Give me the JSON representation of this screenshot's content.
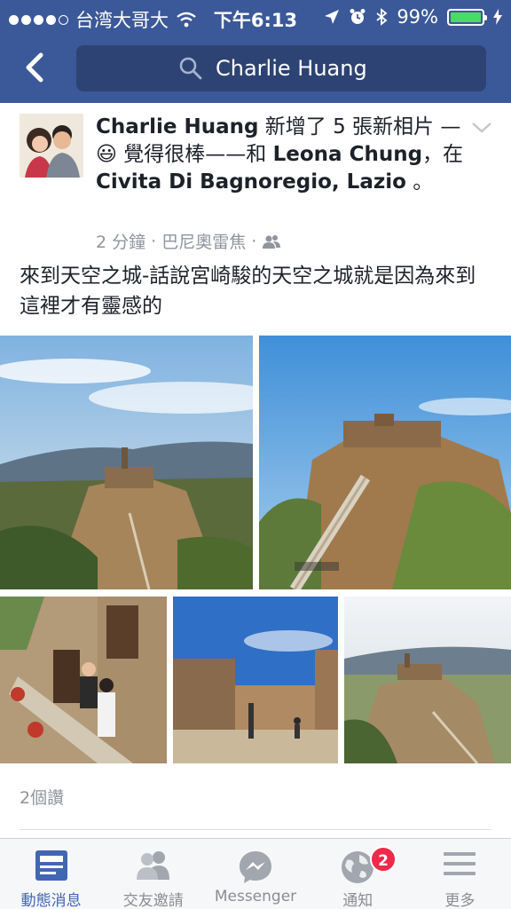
{
  "status_bar": {
    "carrier": "台湾大哥大",
    "time": "下午6:13",
    "battery": "99%",
    "battery_level": 0.99
  },
  "nav": {
    "search_text": "Charlie Huang"
  },
  "post": {
    "author": "Charlie Huang",
    "action": " 新增了 5 張新相片 — ",
    "feeling_emoji": "😃",
    "feeling": " 覺得很棒——和 ",
    "tagged": "Leona Chung",
    "at": "，在 ",
    "place": "Civita Di Bagnoregio, Lazio",
    "end": " 。",
    "time": "2 分鐘",
    "location_meta": "巴尼奧雷焦",
    "separator": "·",
    "text": "來到天空之城-話說宮崎駿的天空之城就是因為來到這裡才有靈感的",
    "likes": "2個讚",
    "photo_count": 5
  },
  "tabs": [
    {
      "label": "動態消息",
      "icon": "news-feed-icon",
      "active": true
    },
    {
      "label": "交友邀請",
      "icon": "friend-requests-icon",
      "active": false
    },
    {
      "label": "Messenger",
      "icon": "messenger-icon",
      "active": false
    },
    {
      "label": "通知",
      "icon": "notifications-globe-icon",
      "active": false,
      "badge": "2"
    },
    {
      "label": "更多",
      "icon": "menu-icon",
      "active": false
    }
  ],
  "colors": {
    "brand": "#3b5998",
    "active_tab": "#4267b2",
    "badge": "#f02849",
    "battery": "#4cd964"
  }
}
